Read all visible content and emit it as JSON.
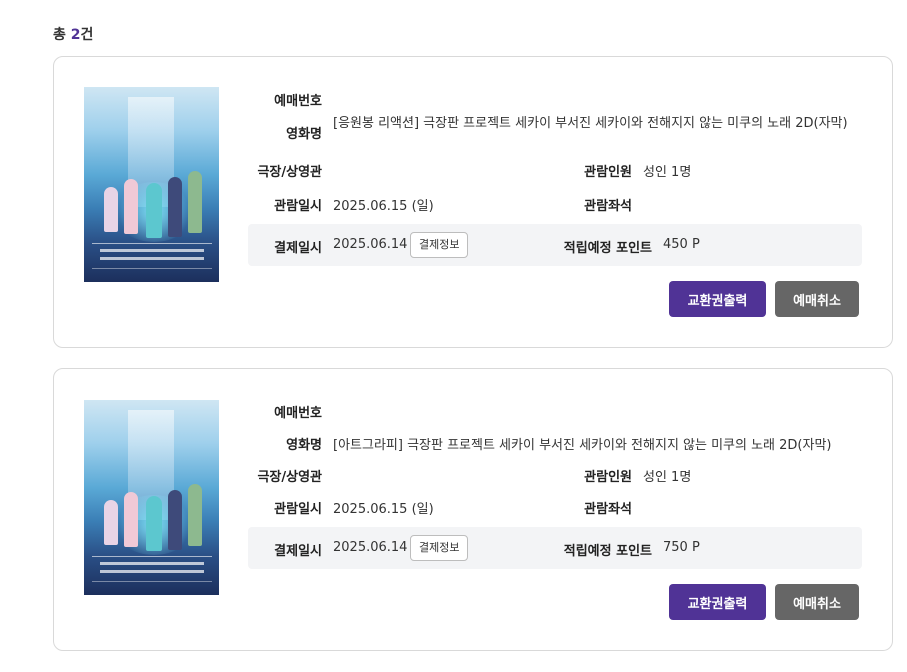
{
  "summary": {
    "prefix": "총 ",
    "count": "2",
    "suffix": "건"
  },
  "labels": {
    "booking_no": "예매번호",
    "movie": "영화명",
    "theater": "극장/상영관",
    "viewers": "관람인원",
    "date": "관람일시",
    "seat": "관람좌석",
    "paid": "결제일시",
    "points": "적립예정 포인트",
    "pay_info_btn": "결제정보",
    "print_btn": "교환권출력",
    "cancel_btn": "예매취소"
  },
  "reservations": [
    {
      "booking_no": "",
      "movie": "[응원봉 리액션] 극장판 프로젝트 세카이 부서진 세카이와 전해지지 않는 미쿠의 노래 2D(자막)",
      "theater": "",
      "viewers": "성인 1명",
      "date": "2025.06.15 (일)",
      "seat": "",
      "paid": "2025.06.14",
      "points": "450 P"
    },
    {
      "booking_no": "",
      "movie": "[아트그라피] 극장판 프로젝트 세카이 부서진 세카이와 전해지지 않는 미쿠의 노래 2D(자막)",
      "theater": "",
      "viewers": "성인 1명",
      "date": "2025.06.15 (일)",
      "seat": "",
      "paid": "2025.06.14",
      "points": "750 P"
    }
  ],
  "colors": {
    "accent": "#503396",
    "secondary_button": "#666666",
    "pay_bar": "#f3f4f6"
  },
  "icons": {
    "poster": "movie-poster-image"
  }
}
